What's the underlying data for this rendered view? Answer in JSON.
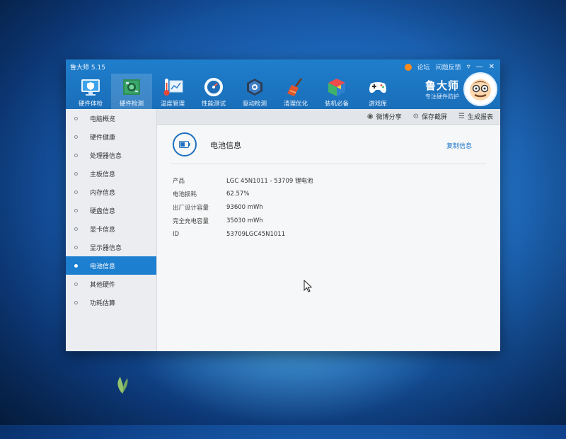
{
  "window": {
    "app_title": "鲁大师 5.15",
    "top_links": [
      "论坛",
      "问题反馈"
    ],
    "controls": [
      "▿",
      "—",
      "✕"
    ]
  },
  "nav": {
    "items": [
      {
        "label": "硬件体检",
        "icon": "monitor-shield-icon"
      },
      {
        "label": "硬件检测",
        "icon": "circuit-board-icon"
      },
      {
        "label": "温度管理",
        "icon": "thermometer-chart-icon"
      },
      {
        "label": "性能测试",
        "icon": "speedometer-icon"
      },
      {
        "label": "驱动检测",
        "icon": "gear-chip-icon"
      },
      {
        "label": "清理优化",
        "icon": "broom-icon"
      },
      {
        "label": "装机必备",
        "icon": "package-box-icon"
      },
      {
        "label": "游戏库",
        "icon": "gamepad-icon"
      }
    ],
    "active_index": 1
  },
  "brand": {
    "name": "鲁大师",
    "subtitle": "专注硬件防护"
  },
  "sidebar": {
    "items": [
      {
        "label": "电脑概览"
      },
      {
        "label": "硬件健康"
      },
      {
        "label": "处理器信息"
      },
      {
        "label": "主板信息"
      },
      {
        "label": "内存信息"
      },
      {
        "label": "硬盘信息"
      },
      {
        "label": "显卡信息"
      },
      {
        "label": "显示器信息"
      },
      {
        "label": "电池信息"
      },
      {
        "label": "其他硬件"
      },
      {
        "label": "功耗估算"
      }
    ],
    "active_index": 8
  },
  "toolbar": {
    "share_label": "微博分享",
    "screenshot_label": "保存截屏",
    "report_label": "生成报表"
  },
  "section": {
    "title": "电池信息",
    "copy_label": "复制信息",
    "rows": [
      {
        "label": "产品",
        "value": "LGC 45N1011 - 53709 锂电池"
      },
      {
        "label": "电池损耗",
        "value": "62.57%"
      },
      {
        "label": "出厂设计容量",
        "value": "93600 mWh"
      },
      {
        "label": "完全充电容量",
        "value": "35030 mWh"
      },
      {
        "label": "ID",
        "value": "53709LGC45N1011"
      }
    ]
  },
  "colors": {
    "topbar": "#1a6eb9",
    "accent": "#1d7fd0",
    "desktop": "#1d67b9"
  }
}
